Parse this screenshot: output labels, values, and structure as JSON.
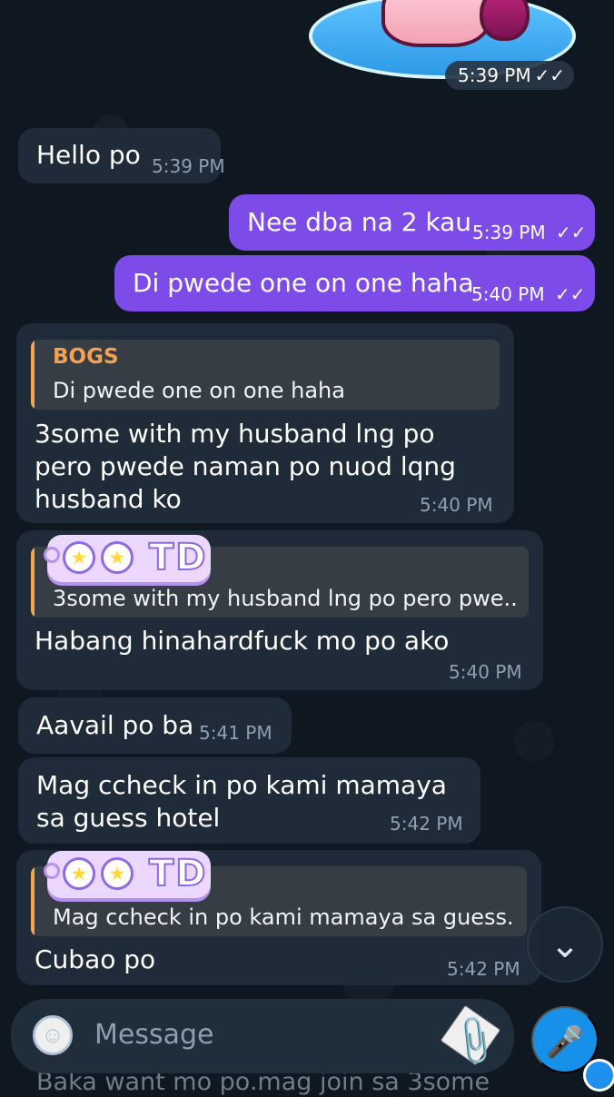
{
  "top_sticker": {
    "time": "5:39 PM",
    "checks_icon": "double-check-icon"
  },
  "messages": [
    {
      "text": "Hello po",
      "time": "5:39 PM"
    },
    {
      "text": "Nee dba na 2 kau",
      "time": "5:39 PM",
      "checks_icon": "double-check-icon"
    },
    {
      "text": "Di pwede one on one haha",
      "time": "5:40 PM",
      "checks_icon": "double-check-icon"
    },
    {
      "quote_name": "BOGS",
      "quote_text": "Di pwede one on one haha",
      "text": "3some with my husband lng po pero pwede naman po nuod lqng husband ko",
      "time": "5:40 PM"
    },
    {
      "tag_text": "TD",
      "quote_text": "3some with my husband lng po pero pwe...",
      "text": "Habang hinahardfuck mo po ako",
      "time": "5:40 PM"
    },
    {
      "text": "Aavail po ba",
      "time": "5:41 PM"
    },
    {
      "text": "Mag ccheck in po kami mamaya sa guess hotel",
      "time": "5:42 PM"
    },
    {
      "tag_text": "TD",
      "quote_text": "Mag ccheck in po kami mamaya sa guess...",
      "text": "Cubao po",
      "time": "5:42 PM"
    }
  ],
  "composer": {
    "placeholder": "Message",
    "emoji_icon": "emoji-icon",
    "attach_icon": "paperclip-icon",
    "mic_icon": "microphone-icon"
  },
  "scroll_icon": "chevron-down-icon",
  "bottom_preview": "Baka want mo po.mag join sa 3some",
  "colors": {
    "background": "#0f1721",
    "incoming": "#1f2b38",
    "outgoing": "#7d4be7",
    "accent": "#1690e8",
    "quote_name": "#f5a14f"
  }
}
